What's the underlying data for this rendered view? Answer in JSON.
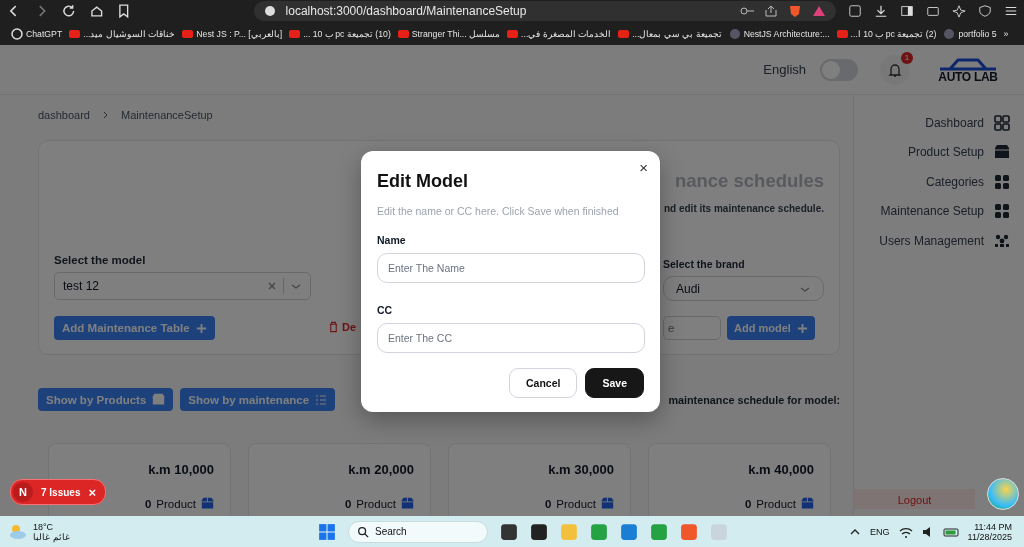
{
  "browser": {
    "url": "localhost:3000/dashboard/MaintenanceSetup",
    "bookmarks": [
      "ChatGPT",
      "خناقات السوشيال ميد...",
      "Nest JS : P... [بالعربي]",
      "(10) تجميعة pc ب 10 ...",
      "Stranger Thi... مسلسل",
      "الخدمات المصغرة في...",
      "تجميعة بي سي بمعال...",
      "NestJS Architecture:...",
      "(2) تجميعة pc ب 10 ا...",
      "portfolio 5"
    ],
    "more": "»"
  },
  "header": {
    "language": "English",
    "toggle_on": false,
    "notification_count": "1",
    "logo": "AUTO LAB"
  },
  "breadcrumb": [
    "dashboard",
    "MaintenanceSetup"
  ],
  "setup_card": {
    "title": "nance schedules",
    "subtitle": "nd edit its maintenance schedule.",
    "model_label": "Select the model",
    "model_value": "test 12",
    "brand_label": "Select the brand",
    "brand_value": "Audi",
    "add_table_button": "Add Maintenance Table",
    "delete_button": "De",
    "model_field": {
      "placeholder": "e"
    },
    "add_model_button": "Add model"
  },
  "view_buttons": [
    "Show by Products",
    "Show by maintenance"
  ],
  "schedule_heading": "maintenance schedule for model:",
  "intervals": [
    {
      "distance": "k.m 10,000",
      "count": "0",
      "unit": "Product"
    },
    {
      "distance": "k.m 20,000",
      "count": "0",
      "unit": "Product"
    },
    {
      "distance": "k.m 30,000",
      "count": "0",
      "unit": "Product"
    },
    {
      "distance": "k.m 40,000",
      "count": "0",
      "unit": "Product"
    }
  ],
  "sidebar": {
    "items": [
      {
        "label": "Dashboard"
      },
      {
        "label": "Product Setup"
      },
      {
        "label": "Categories"
      },
      {
        "label": "Maintenance Setup"
      },
      {
        "label": "Users Management"
      }
    ],
    "logout": "Logout"
  },
  "dev_badge": {
    "letter": "N",
    "issues": "7 Issues",
    "close": "×"
  },
  "modal": {
    "title": "Edit Model",
    "description": "Edit the name or CC here. Click Save when finished",
    "close": "×",
    "fields": [
      {
        "label": "Name",
        "placeholder": "Enter The Name"
      },
      {
        "label": "CC",
        "placeholder": "Enter The CC"
      }
    ],
    "buttons": [
      {
        "label": "Cancel",
        "kind": "secondary"
      },
      {
        "label": "Save",
        "kind": "primary"
      }
    ]
  },
  "taskbar": {
    "temperature": "18°C",
    "weather": "غائم غالبا",
    "search": {
      "placeholder": "Search"
    },
    "language": "ENG",
    "time": "11:44 PM",
    "date": "11/28/2025"
  }
}
